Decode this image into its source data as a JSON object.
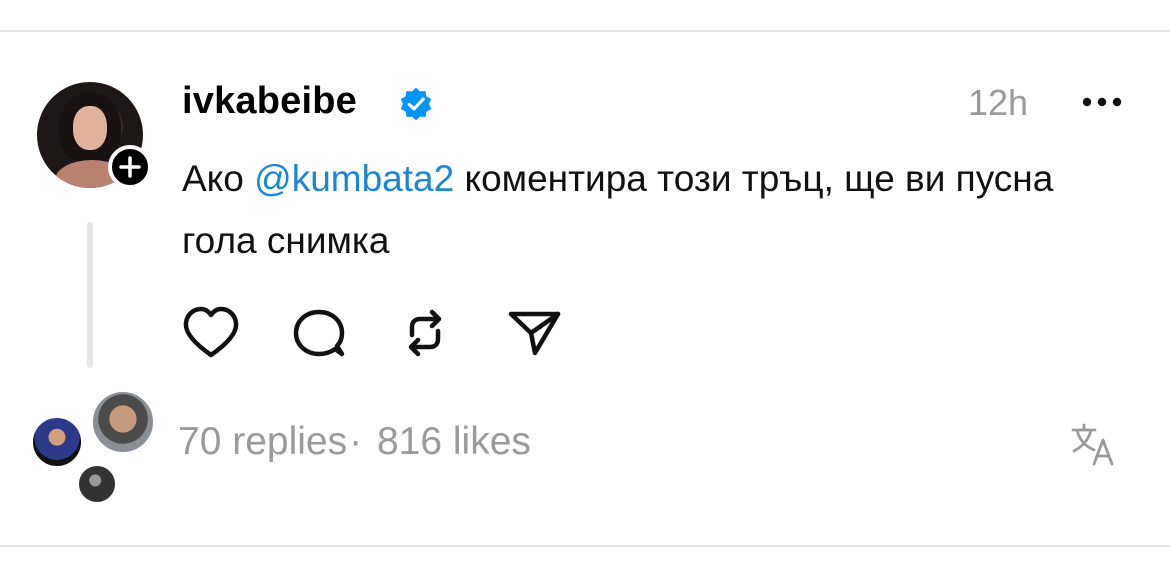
{
  "post": {
    "username": "ivkabeibe",
    "time": "12h",
    "text_prefix": "Ако ",
    "mention": "@kumbata2",
    "text_suffix": " коментира този тръц, ще ви пусна гола снимка"
  },
  "stats": {
    "replies": "70 replies",
    "separator": "·",
    "likes": "816 likes"
  },
  "icons": {
    "verified": "verified-badge-icon",
    "more": "more-dots-icon",
    "follow": "plus-icon",
    "like": "heart-icon",
    "comment": "comment-icon",
    "repost": "repost-icon",
    "share": "send-icon",
    "translate": "translate-icon"
  },
  "colors": {
    "mention": "#1c86d6",
    "verified": "#0095f6",
    "muted": "#9a9a9a"
  }
}
